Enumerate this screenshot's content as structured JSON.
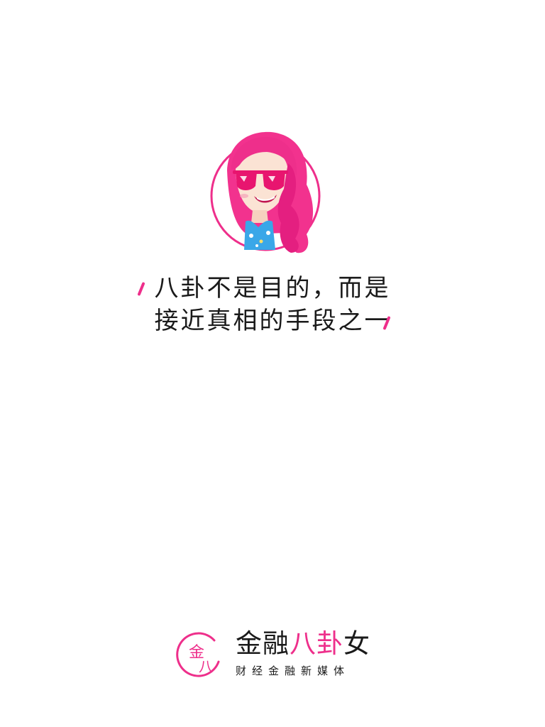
{
  "slogan": {
    "line1": "八卦不是目的，而是",
    "line2": "接近真相的手段之一"
  },
  "brand": {
    "name_part1": "金融",
    "name_part2": "八卦",
    "name_part3": "女",
    "tagline": "财经金融新媒体",
    "logo_glyph_1": "金",
    "logo_glyph_2": "八"
  },
  "colors": {
    "accent": "#ee2f8b",
    "text": "#1a1a1a",
    "background": "#ffffff",
    "glasses": "#e8156f",
    "swimsuit": "#3aa7e8"
  },
  "icons": {
    "avatar": "cartoon-woman-pink-hair-sunglasses-icon",
    "slash_left": "pink-slash-left-icon",
    "slash_right": "pink-slash-right-icon",
    "logo": "circle-jin-ba-logo-icon"
  }
}
